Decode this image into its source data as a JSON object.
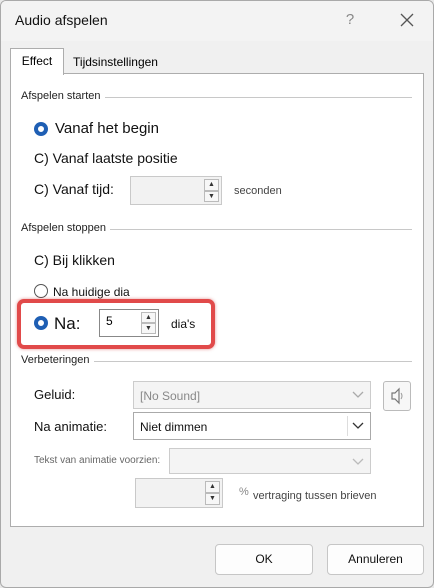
{
  "dialog": {
    "title": "Audio afspelen",
    "help_glyph": "?",
    "tabs": [
      {
        "label": "Effect",
        "selected": true
      },
      {
        "label": "Tijdsinstellingen",
        "selected": false
      }
    ]
  },
  "start_group": {
    "label": "Afspelen starten",
    "options": {
      "from_start": "Vanaf het begin",
      "from_last": "C) Vanaf laatste positie",
      "from_time": "C) Vanaf tijd:"
    },
    "time_value": "",
    "time_unit": "seconden"
  },
  "stop_group": {
    "label": "Afspelen stoppen",
    "options": {
      "on_click": "C) Bij klikken",
      "after_current": "Na huidige dia",
      "after": "Na:"
    },
    "after_value": "5",
    "after_unit": "dia's"
  },
  "enhancements": {
    "label": "Verbeteringen",
    "sound_label": "Geluid:",
    "sound_value": "[No Sound]",
    "after_anim_label": "Na animatie:",
    "after_anim_value": "Niet dimmen",
    "animate_text_label": "Tekst van animatie voorzien:",
    "animate_text_value": "",
    "delay_value": "",
    "delay_percent": "%",
    "delay_label": "vertraging tussen brieven"
  },
  "buttons": {
    "ok": "OK",
    "cancel": "Annuleren"
  },
  "colors": {
    "accent": "#1f5fb4",
    "highlight": "#e14a4a"
  }
}
